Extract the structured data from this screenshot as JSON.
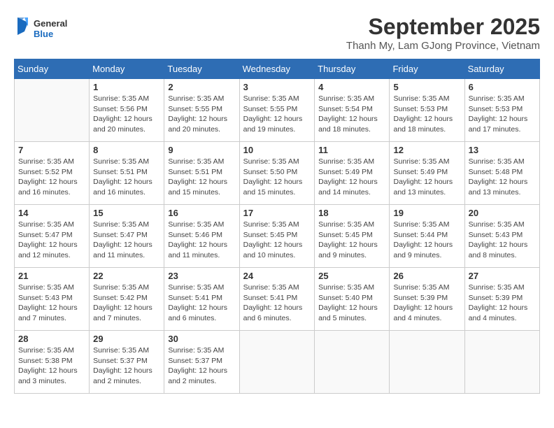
{
  "logo": {
    "line1": "General",
    "line2": "Blue"
  },
  "title": "September 2025",
  "location": "Thanh My, Lam GJong Province, Vietnam",
  "days_of_week": [
    "Sunday",
    "Monday",
    "Tuesday",
    "Wednesday",
    "Thursday",
    "Friday",
    "Saturday"
  ],
  "weeks": [
    [
      {
        "day": "",
        "info": ""
      },
      {
        "day": "1",
        "info": "Sunrise: 5:35 AM\nSunset: 5:56 PM\nDaylight: 12 hours\nand 20 minutes."
      },
      {
        "day": "2",
        "info": "Sunrise: 5:35 AM\nSunset: 5:55 PM\nDaylight: 12 hours\nand 20 minutes."
      },
      {
        "day": "3",
        "info": "Sunrise: 5:35 AM\nSunset: 5:55 PM\nDaylight: 12 hours\nand 19 minutes."
      },
      {
        "day": "4",
        "info": "Sunrise: 5:35 AM\nSunset: 5:54 PM\nDaylight: 12 hours\nand 18 minutes."
      },
      {
        "day": "5",
        "info": "Sunrise: 5:35 AM\nSunset: 5:53 PM\nDaylight: 12 hours\nand 18 minutes."
      },
      {
        "day": "6",
        "info": "Sunrise: 5:35 AM\nSunset: 5:53 PM\nDaylight: 12 hours\nand 17 minutes."
      }
    ],
    [
      {
        "day": "7",
        "info": "Sunrise: 5:35 AM\nSunset: 5:52 PM\nDaylight: 12 hours\nand 16 minutes."
      },
      {
        "day": "8",
        "info": "Sunrise: 5:35 AM\nSunset: 5:51 PM\nDaylight: 12 hours\nand 16 minutes."
      },
      {
        "day": "9",
        "info": "Sunrise: 5:35 AM\nSunset: 5:51 PM\nDaylight: 12 hours\nand 15 minutes."
      },
      {
        "day": "10",
        "info": "Sunrise: 5:35 AM\nSunset: 5:50 PM\nDaylight: 12 hours\nand 15 minutes."
      },
      {
        "day": "11",
        "info": "Sunrise: 5:35 AM\nSunset: 5:49 PM\nDaylight: 12 hours\nand 14 minutes."
      },
      {
        "day": "12",
        "info": "Sunrise: 5:35 AM\nSunset: 5:49 PM\nDaylight: 12 hours\nand 13 minutes."
      },
      {
        "day": "13",
        "info": "Sunrise: 5:35 AM\nSunset: 5:48 PM\nDaylight: 12 hours\nand 13 minutes."
      }
    ],
    [
      {
        "day": "14",
        "info": "Sunrise: 5:35 AM\nSunset: 5:47 PM\nDaylight: 12 hours\nand 12 minutes."
      },
      {
        "day": "15",
        "info": "Sunrise: 5:35 AM\nSunset: 5:47 PM\nDaylight: 12 hours\nand 11 minutes."
      },
      {
        "day": "16",
        "info": "Sunrise: 5:35 AM\nSunset: 5:46 PM\nDaylight: 12 hours\nand 11 minutes."
      },
      {
        "day": "17",
        "info": "Sunrise: 5:35 AM\nSunset: 5:45 PM\nDaylight: 12 hours\nand 10 minutes."
      },
      {
        "day": "18",
        "info": "Sunrise: 5:35 AM\nSunset: 5:45 PM\nDaylight: 12 hours\nand 9 minutes."
      },
      {
        "day": "19",
        "info": "Sunrise: 5:35 AM\nSunset: 5:44 PM\nDaylight: 12 hours\nand 9 minutes."
      },
      {
        "day": "20",
        "info": "Sunrise: 5:35 AM\nSunset: 5:43 PM\nDaylight: 12 hours\nand 8 minutes."
      }
    ],
    [
      {
        "day": "21",
        "info": "Sunrise: 5:35 AM\nSunset: 5:43 PM\nDaylight: 12 hours\nand 7 minutes."
      },
      {
        "day": "22",
        "info": "Sunrise: 5:35 AM\nSunset: 5:42 PM\nDaylight: 12 hours\nand 7 minutes."
      },
      {
        "day": "23",
        "info": "Sunrise: 5:35 AM\nSunset: 5:41 PM\nDaylight: 12 hours\nand 6 minutes."
      },
      {
        "day": "24",
        "info": "Sunrise: 5:35 AM\nSunset: 5:41 PM\nDaylight: 12 hours\nand 6 minutes."
      },
      {
        "day": "25",
        "info": "Sunrise: 5:35 AM\nSunset: 5:40 PM\nDaylight: 12 hours\nand 5 minutes."
      },
      {
        "day": "26",
        "info": "Sunrise: 5:35 AM\nSunset: 5:39 PM\nDaylight: 12 hours\nand 4 minutes."
      },
      {
        "day": "27",
        "info": "Sunrise: 5:35 AM\nSunset: 5:39 PM\nDaylight: 12 hours\nand 4 minutes."
      }
    ],
    [
      {
        "day": "28",
        "info": "Sunrise: 5:35 AM\nSunset: 5:38 PM\nDaylight: 12 hours\nand 3 minutes."
      },
      {
        "day": "29",
        "info": "Sunrise: 5:35 AM\nSunset: 5:37 PM\nDaylight: 12 hours\nand 2 minutes."
      },
      {
        "day": "30",
        "info": "Sunrise: 5:35 AM\nSunset: 5:37 PM\nDaylight: 12 hours\nand 2 minutes."
      },
      {
        "day": "",
        "info": ""
      },
      {
        "day": "",
        "info": ""
      },
      {
        "day": "",
        "info": ""
      },
      {
        "day": "",
        "info": ""
      }
    ]
  ]
}
